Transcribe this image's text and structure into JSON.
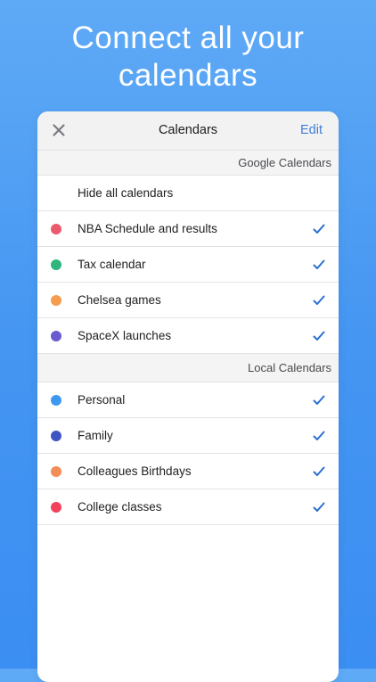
{
  "promo": {
    "line1": "Connect all your",
    "line2": "calendars"
  },
  "navbar": {
    "close_icon": "close-icon",
    "title": "Calendars",
    "edit_label": "Edit"
  },
  "sections": [
    {
      "header": "Google Calendars",
      "hide_all_label": "Hide all calendars",
      "items": [
        {
          "label": "NBA Schedule and results",
          "color": "#ec5a6d",
          "checked": true
        },
        {
          "label": "Tax calendar",
          "color": "#2eb67d",
          "checked": true
        },
        {
          "label": "Chelsea games",
          "color": "#f59c4f",
          "checked": true
        },
        {
          "label": "SpaceX launches",
          "color": "#6a5ad0",
          "checked": true
        }
      ]
    },
    {
      "header": "Local Calendars",
      "items": [
        {
          "label": "Personal",
          "color": "#3d98f2",
          "checked": true
        },
        {
          "label": "Family",
          "color": "#3e56c4",
          "checked": true
        },
        {
          "label": "Colleagues Birthdays",
          "color": "#f48c55",
          "checked": true
        },
        {
          "label": "College classes",
          "color": "#f2415a",
          "checked": true
        }
      ]
    }
  ],
  "colors": {
    "accent": "#3d7fd8",
    "check": "#2a6fd1",
    "background_top": "#5faaf6",
    "background_bottom": "#3b8ef2"
  }
}
